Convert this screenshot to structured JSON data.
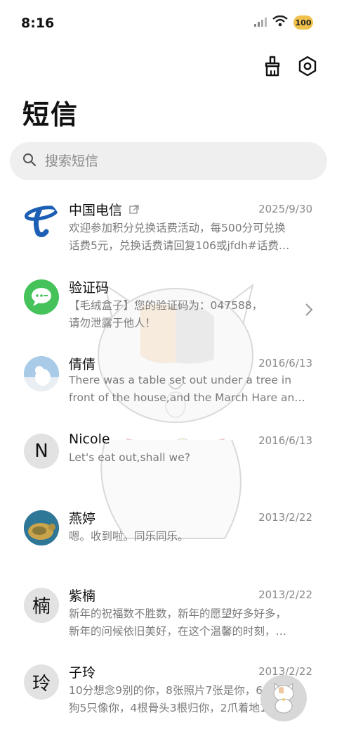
{
  "status_bar": {
    "time": "8:16",
    "battery": "100"
  },
  "header": {
    "title": "短信"
  },
  "search": {
    "placeholder": "搜索短信"
  },
  "conversations": [
    {
      "name": "中国电信",
      "date": "2025/9/30",
      "line1": "欢迎参加积分兑换话费活动，每500分可兑换",
      "line2": "话费5元，兑换话费请回复106或jfdh#话费…",
      "avatar_icon": "china-telecom-logo"
    },
    {
      "name": "验证码",
      "date": "",
      "line1": "【毛绒盒子】您的验证码为：047588，",
      "line2": "请勿泄露于他人！",
      "avatar_icon": "message-bubble-icon"
    },
    {
      "name": "倩倩",
      "date": "2016/6/13",
      "line1": "There was a table set out under a tree in",
      "line2": "front of the house,and the March Hare an…",
      "avatar_icon": "polar-bear-photo"
    },
    {
      "name": "Nicole",
      "date": "2016/6/13",
      "line1": "Let's eat out,shall we?",
      "line2": "",
      "avatar_letter": "N"
    },
    {
      "name": "燕婷",
      "date": "2013/2/22",
      "line1": "嗯。收到啦。同乐同乐。",
      "line2": "",
      "avatar_icon": "sea-turtle-photo"
    },
    {
      "name": "紫楠",
      "date": "2013/2/22",
      "line1": "新年的祝福数不胜数，新年的愿望好多好多，",
      "line2": "新年的问候依旧美好，在这个温馨的时刻，…",
      "avatar_letter": "楠"
    },
    {
      "name": "子玲",
      "date": "2013/2/22",
      "line1": "10分想念9别的你，8张照片7张是你，6只小",
      "line2": "狗5只像你，4根骨头3根归你，2爪着地1定…",
      "avatar_letter": "玲"
    }
  ]
}
